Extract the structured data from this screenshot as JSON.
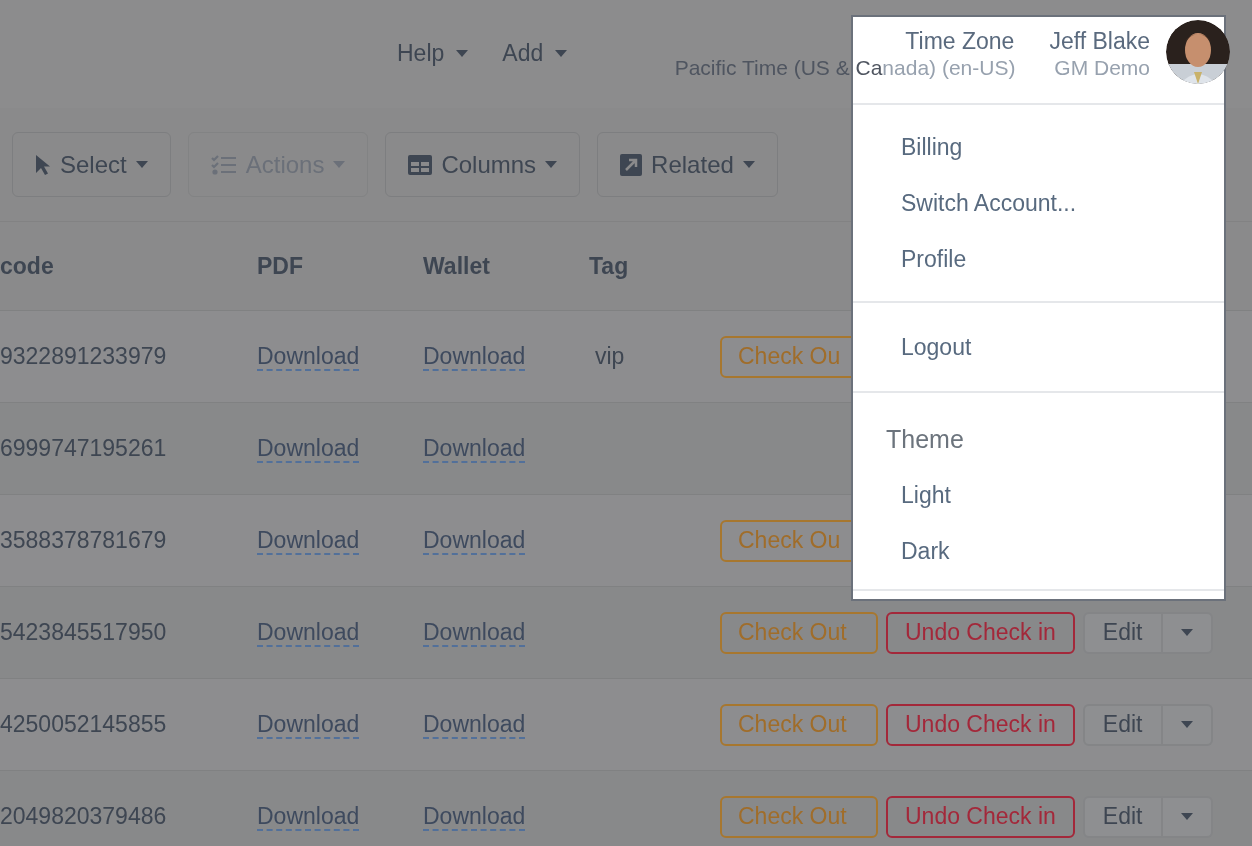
{
  "nav": [
    {
      "label": "Help"
    },
    {
      "label": "Add"
    }
  ],
  "time_zone": {
    "title": "Time Zone",
    "value_outside": "Pacific Time (US & Ca",
    "value_inside": "nada) (en-US)"
  },
  "user": {
    "name": "Jeff Blake",
    "account": "GM Demo"
  },
  "toolbar": [
    {
      "label": "Select",
      "kind": "pointer",
      "disabled": false
    },
    {
      "label": "Actions",
      "kind": "checklist",
      "disabled": true
    },
    {
      "label": "Columns",
      "kind": "table",
      "disabled": false
    },
    {
      "label": "Related",
      "kind": "external",
      "disabled": false
    }
  ],
  "table": {
    "columns": [
      "code",
      "PDF",
      "Wallet",
      "Tag"
    ],
    "rows": [
      {
        "code": "9322891233979",
        "pdf": "Download",
        "wallet": "Download",
        "tag": "vip",
        "actions": [
          {
            "kind": "checkout",
            "label": "Check Ou"
          }
        ]
      },
      {
        "code": "6999747195261",
        "pdf": "Download",
        "wallet": "Download",
        "actions": []
      },
      {
        "code": "3588378781679",
        "pdf": "Download",
        "wallet": "Download",
        "actions": [
          {
            "kind": "checkout",
            "label": "Check Ou"
          }
        ]
      },
      {
        "code": "5423845517950",
        "pdf": "Download",
        "wallet": "Download",
        "actions": [
          {
            "kind": "checkout",
            "label": "Check Out"
          },
          {
            "kind": "undo",
            "label": "Undo Check in"
          },
          {
            "kind": "edit",
            "label": "Edit"
          }
        ]
      },
      {
        "code": "4250052145855",
        "pdf": "Download",
        "wallet": "Download",
        "actions": [
          {
            "kind": "checkout",
            "label": "Check Out"
          },
          {
            "kind": "undo",
            "label": "Undo Check in"
          },
          {
            "kind": "edit",
            "label": "Edit"
          }
        ]
      },
      {
        "code": "2049820379486",
        "pdf": "Download",
        "wallet": "Download",
        "actions": [
          {
            "kind": "checkout",
            "label": "Check Out"
          },
          {
            "kind": "undo",
            "label": "Undo Check in"
          },
          {
            "kind": "edit",
            "label": "Edit"
          }
        ]
      }
    ]
  },
  "menu": {
    "groups": [
      {
        "items": [
          {
            "label": "Billing"
          },
          {
            "label": "Switch Account..."
          },
          {
            "label": "Profile"
          }
        ]
      },
      {
        "items": [
          {
            "label": "Logout"
          }
        ]
      },
      {
        "heading": "Theme",
        "items": [
          {
            "label": "Light"
          },
          {
            "label": "Dark"
          }
        ]
      }
    ]
  }
}
